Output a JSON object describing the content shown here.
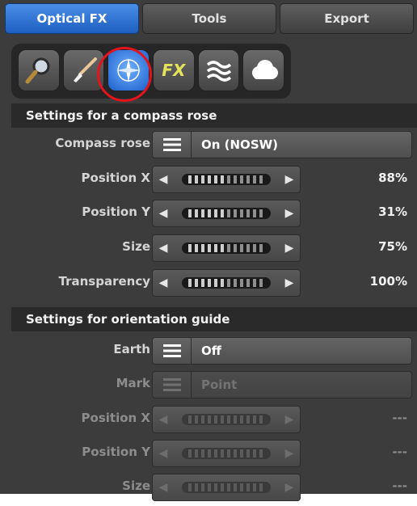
{
  "tabs": [
    {
      "label": "Optical FX",
      "active": true
    },
    {
      "label": "Tools",
      "active": false
    },
    {
      "label": "Export",
      "active": false
    }
  ],
  "toolbar": {
    "tools": [
      {
        "icon": "magnifier-icon"
      },
      {
        "icon": "brush-icon"
      },
      {
        "icon": "compass-rose-icon",
        "active": true
      },
      {
        "icon": "fx-icon",
        "text": "FX"
      },
      {
        "icon": "waves-icon"
      },
      {
        "icon": "cloud-icon"
      }
    ]
  },
  "compass_section": {
    "title": "Settings for a compass rose",
    "compass_rose": {
      "label": "Compass rose",
      "value": "On (NOSW)"
    },
    "position_x": {
      "label": "Position X",
      "value": "88%",
      "level": 0.88
    },
    "position_y": {
      "label": "Position Y",
      "value": "31%",
      "level": 0.31
    },
    "size": {
      "label": "Size",
      "value": "75%",
      "level": 0.75
    },
    "transparency": {
      "label": "Transparency",
      "value": "100%",
      "level": 1.0
    }
  },
  "orientation_section": {
    "title": "Settings for orientation guide",
    "earth": {
      "label": "Earth",
      "value": "Off"
    },
    "mark": {
      "label": "Mark",
      "value": "Point"
    },
    "position_x": {
      "label": "Position X",
      "value": "---"
    },
    "position_y": {
      "label": "Position Y",
      "value": "---"
    },
    "size": {
      "label": "Size",
      "value": "---"
    }
  },
  "colors": {
    "accent": "#1d5fbf",
    "highlight_ring": "#e3141c",
    "panel": "#3c3c3c"
  }
}
